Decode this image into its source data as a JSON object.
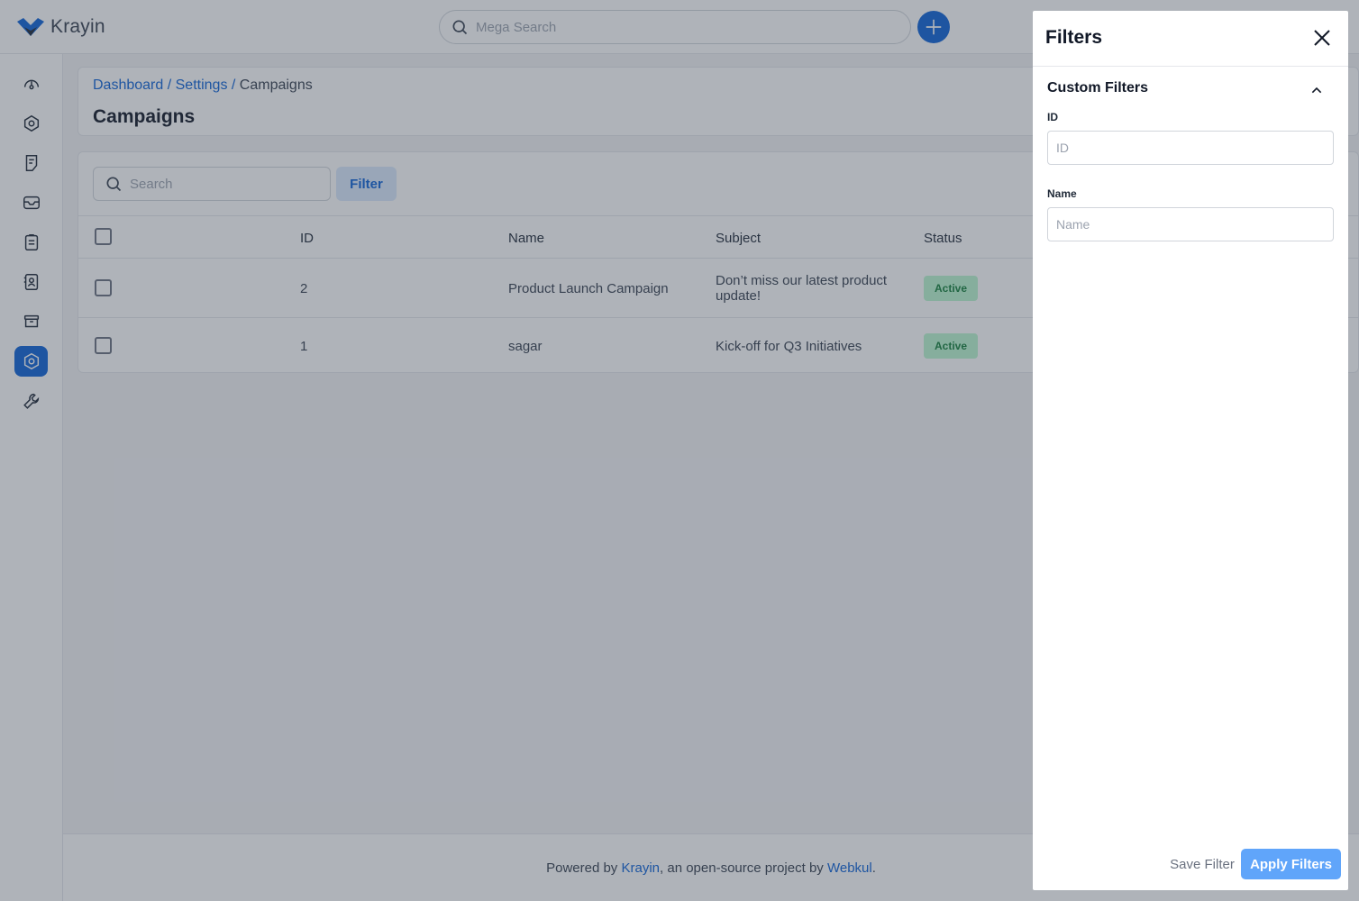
{
  "app": {
    "name": "Krayin"
  },
  "colors": {
    "accent": "#0e63d8",
    "badge_bg": "#bbf7d0",
    "badge_text": "#15803d",
    "apply_button": "#60a5fa"
  },
  "header": {
    "mega_search": {
      "placeholder": "Mega Search",
      "icon": "search-icon"
    },
    "quick_add": {
      "icon": "plus-icon"
    }
  },
  "sidebar": {
    "items": [
      {
        "icon": "dashboard-icon"
      },
      {
        "icon": "leads-icon"
      },
      {
        "icon": "quotes-icon"
      },
      {
        "icon": "mail-icon"
      },
      {
        "icon": "activities-icon"
      },
      {
        "icon": "contacts-icon"
      },
      {
        "icon": "products-icon"
      },
      {
        "icon": "settings-icon",
        "active": true
      },
      {
        "icon": "configuration-icon"
      }
    ]
  },
  "breadcrumb": {
    "dashboard": "Dashboard",
    "separator": " / ",
    "settings": "Settings",
    "current": "Campaigns"
  },
  "page": {
    "title": "Campaigns"
  },
  "grid": {
    "search_placeholder": "Search",
    "filter_label": "Filter",
    "columns": [
      "ID",
      "Name",
      "Subject",
      "Status"
    ],
    "rows": [
      {
        "id": "2",
        "name": "Product Launch Campaign",
        "subject_line1": "Don’t miss our latest product",
        "subject_line2": "update!",
        "status": "Active"
      },
      {
        "id": "1",
        "name": "sagar",
        "subject_line1": "Kick-off for Q3 Initiatives",
        "subject_line2": "",
        "status": "Active"
      }
    ]
  },
  "footer": {
    "prefix": "Powered by ",
    "link1": "Krayin",
    "middle": ", an open-source project by ",
    "link2": "Webkul",
    "suffix": "."
  },
  "drawer": {
    "title": "Filters",
    "section_title": "Custom Filters",
    "fields": [
      {
        "label": "ID",
        "placeholder": "ID"
      },
      {
        "label": "Name",
        "placeholder": "Name"
      }
    ],
    "save_label": "Save Filter",
    "apply_label": "Apply Filters"
  }
}
